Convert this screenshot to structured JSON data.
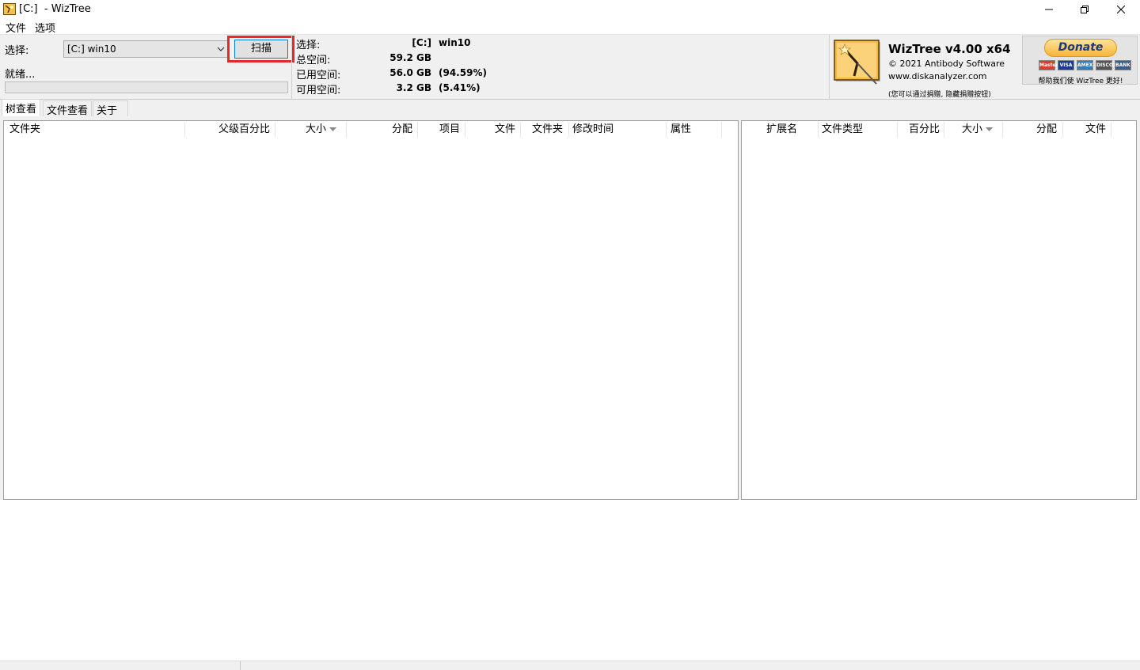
{
  "window": {
    "title": "[C:]  - WizTree",
    "icon": "wiztree-app-icon",
    "controls": [
      "minimize-icon",
      "restore-icon",
      "close-icon"
    ]
  },
  "menu": {
    "file": "文件",
    "options": "选项"
  },
  "scan_panel": {
    "select_label": "选择:",
    "drive_value": "[C:] win10",
    "scan_button": "扫描",
    "status": "就绪..."
  },
  "drive_info": {
    "select_label": "选择:",
    "select_drive": "[C:]",
    "select_name": "win10",
    "total_label": "总空间:",
    "total_value": "59.2 GB",
    "used_label": "已用空间:",
    "used_value": "56.0 GB",
    "used_pct": "(94.59%)",
    "free_label": "可用空间:",
    "free_value": "3.2 GB",
    "free_pct": "(5.41%)"
  },
  "about": {
    "title": "WizTree v4.00 x64",
    "copyright": "© 2021 Antibody Software",
    "website": "www.diskanalyzer.com",
    "note": "(您可以通过捐赠, 隐藏捐赠按钮)"
  },
  "donate": {
    "button": "Donate",
    "cards": [
      "MasterCard",
      "VISA",
      "AMEX",
      "DISCOVER",
      "BANK"
    ],
    "note": "帮助我们使 WizTree 更好!"
  },
  "tabs": [
    "树查看",
    "文件查看",
    "关于"
  ],
  "tree_columns": [
    "文件夹",
    "父级百分比",
    "大小",
    "分配",
    "项目",
    "文件",
    "文件夹",
    "修改时间",
    "属性"
  ],
  "ext_columns": [
    "扩展名",
    "文件类型",
    "百分比",
    "大小",
    "分配",
    "文件"
  ],
  "colors": {
    "highlight": "#e8262b",
    "focus_border": "#0078d7",
    "panel_bg": "#f0f0f0"
  }
}
